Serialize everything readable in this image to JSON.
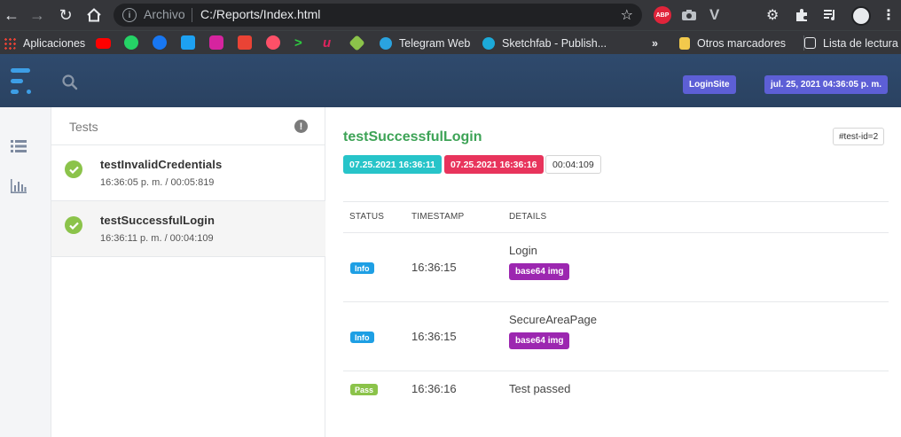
{
  "browser": {
    "omnibox": {
      "scheme_label": "Archivo",
      "url": "C:/Reports/Index.html"
    },
    "extensions": [
      "abp",
      "camera",
      "vivaldi",
      "gear",
      "puzzle",
      "playlist",
      "avatar"
    ],
    "abp_label": "ABP",
    "bookmarks": {
      "apps_label": "Aplicaciones",
      "telegram_label": "Telegram Web",
      "sketchfab_label": "Sketchfab - Publish...",
      "more_label": "»",
      "other_label": "Otros marcadores",
      "reading_label": "Lista de lectura"
    }
  },
  "header": {
    "app_badge": "LoginSite",
    "datetime_badge": "jul. 25, 2021 04:36:05 p. m."
  },
  "sidebar": {
    "items": [
      "list-icon",
      "chart-bar-icon"
    ]
  },
  "tests": {
    "title": "Tests",
    "items": [
      {
        "name": "testInvalidCredentials",
        "meta": "16:36:05 p. m. / 00:05:819",
        "status": "pass"
      },
      {
        "name": "testSuccessfulLogin",
        "meta": "16:36:11 p. m. / 00:04:109",
        "status": "pass"
      }
    ]
  },
  "detail": {
    "title": "testSuccessfulLogin",
    "test_id": "#test-id=2",
    "start_time": "07.25.2021 16:36:11",
    "end_time": "07.25.2021 16:36:16",
    "duration": "00:04:109",
    "columns": [
      "STATUS",
      "TIMESTAMP",
      "DETAILS"
    ],
    "rows": [
      {
        "status": "Info",
        "timestamp": "16:36:15",
        "details": "Login",
        "badge": "base64 img"
      },
      {
        "status": "Info",
        "timestamp": "16:36:15",
        "details": "SecureAreaPage",
        "badge": "base64 img"
      },
      {
        "status": "Pass",
        "timestamp": "16:36:16",
        "details": "Test passed",
        "badge": ""
      }
    ]
  },
  "colors": {
    "header_bg": "#2b4263",
    "pass_green": "#8bc34a",
    "title_green": "#3da356",
    "info_blue": "#1e9fe4",
    "start_cyan": "#27c4c9",
    "end_red": "#e8345c",
    "badge_purple": "#9c27b0",
    "badge_indigo": "#5d5fd6"
  }
}
